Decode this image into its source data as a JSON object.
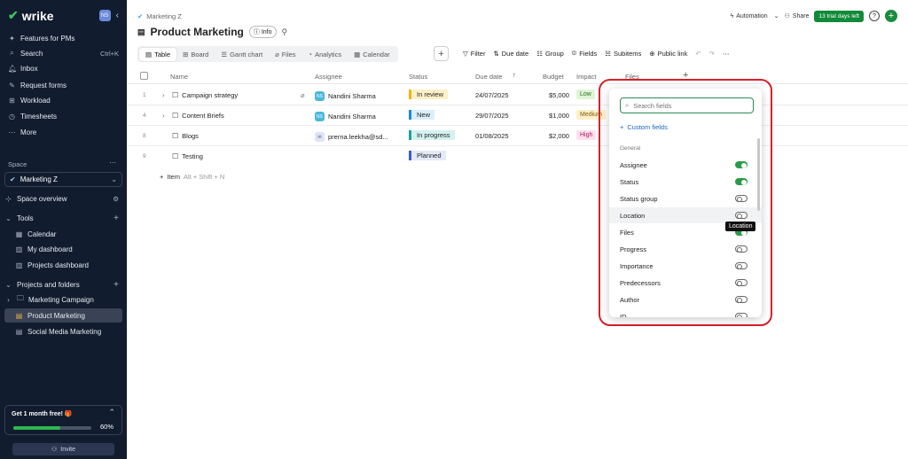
{
  "app": {
    "logo": "wrike",
    "user_initials": "NS"
  },
  "sidebar": {
    "features": "Features for PMs",
    "search": "Search",
    "search_shortcut": "Ctrl+K",
    "inbox": "Inbox",
    "request_forms": "Request forms",
    "workload": "Workload",
    "timesheets": "Timesheets",
    "more": "More",
    "space_label": "Space",
    "space_selected": "Marketing Z",
    "space_overview": "Space overview",
    "tools": "Tools",
    "calendar": "Calendar",
    "my_dashboard": "My dashboard",
    "projects_dashboard": "Projects dashboard",
    "projects_folders": "Projects and folders",
    "projects": [
      {
        "label": "Marketing Campaign"
      },
      {
        "label": "Product Marketing"
      },
      {
        "label": "Social Media Marketing"
      }
    ],
    "promo": {
      "title": "Get 1 month free! 🎁",
      "progress_text": "60%",
      "progress": 0.6
    },
    "invite": "Invite"
  },
  "header": {
    "breadcrumb": "Marketing Z",
    "title": "Product Marketing",
    "info": "Info",
    "automation": "Automation",
    "share": "Share",
    "trial": "13 trial days left"
  },
  "views": [
    "Table",
    "Board",
    "Gantt chart",
    "Files",
    "Analytics",
    "Calendar"
  ],
  "toolbar": {
    "filter": "Filter",
    "due_date": "Due date",
    "group": "Group",
    "fields": "Fields",
    "subitems": "Subitems",
    "public_link": "Public link"
  },
  "columns": [
    "Name",
    "Assignee",
    "Status",
    "Due date",
    "Budget",
    "Impact",
    "Files"
  ],
  "rows": [
    {
      "num": "1",
      "name": "Campaign strategy",
      "initials": "NS",
      "assignee": "Nandini Sharma",
      "status": "In review",
      "due": "24/07/2025",
      "budget": "$5,000",
      "impact": "Low"
    },
    {
      "num": "4",
      "name": "Content Briefs",
      "initials": "NS",
      "assignee": "Nandini Sharma",
      "status": "New",
      "due": "29/07/2025",
      "budget": "$1,000",
      "impact": "Medium"
    },
    {
      "num": "8",
      "name": "Blogs",
      "initials": "",
      "assignee": "prerna.leekha@sd...",
      "status": "In progress",
      "due": "01/08/2025",
      "budget": "$2,000",
      "impact": "High"
    },
    {
      "num": "9",
      "name": "Testing",
      "initials": "",
      "assignee": "",
      "status": "Planned",
      "due": "",
      "budget": "",
      "impact": ""
    }
  ],
  "add_item": {
    "label": "Item",
    "hint": "Alt + Shift + N"
  },
  "fields_panel": {
    "search_placeholder": "Search fields",
    "custom_fields": "Custom fields",
    "section": "General",
    "fields": [
      {
        "label": "Assignee",
        "on": true
      },
      {
        "label": "Status",
        "on": true
      },
      {
        "label": "Status group",
        "on": false
      },
      {
        "label": "Location",
        "on": false
      },
      {
        "label": "Files",
        "on": true
      },
      {
        "label": "Progress",
        "on": false
      },
      {
        "label": "Importance",
        "on": false
      },
      {
        "label": "Predecessors",
        "on": false
      },
      {
        "label": "Author",
        "on": false
      },
      {
        "label": "ID",
        "on": false
      }
    ],
    "tooltip": "Location"
  },
  "colors": {
    "sidebar_bg": "#111c2e",
    "accent_green": "#2a9a4a",
    "highlight_red": "#d6202a",
    "link_blue": "#1a65c8"
  }
}
